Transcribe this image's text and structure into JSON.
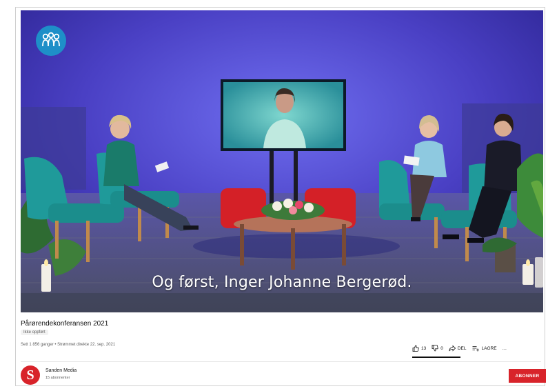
{
  "video": {
    "subtitle": "Og først, Inger Johanne Bergerød.",
    "logo_icon": "people-group-icon"
  },
  "meta": {
    "title": "Pårørendekonferansen 2021",
    "tag": "Ikke oppført",
    "views_line": "Sett 1 856 ganger • Strømmet direkte 22. sep. 2021"
  },
  "actions": {
    "likes": "13",
    "dislikes": "0",
    "share_label": "DEL",
    "save_label": "LAGRE",
    "more_label": "…"
  },
  "channel": {
    "name": "Sanden Media",
    "subscribers": "15 abonnenter",
    "logo_letter": "S",
    "subscribe_label": "ABONNER"
  },
  "colors": {
    "brand_red": "#d8232a",
    "stage_blue": "#4b3fb8",
    "chair_teal": "#1f9a9a"
  }
}
